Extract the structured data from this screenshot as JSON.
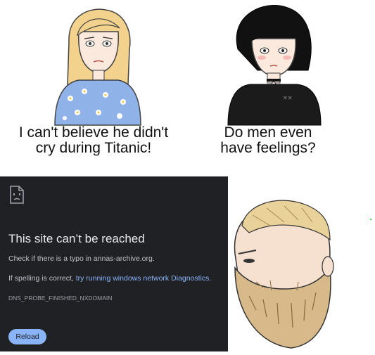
{
  "top_left": {
    "caption_line1": "I can't believe he didn't",
    "caption_line2": "cry during Titanic!"
  },
  "top_right": {
    "caption_line1": "Do men even",
    "caption_line2": "have feelings?"
  },
  "error_page": {
    "title": "This site can’t be reached",
    "check_text": "Check if there is a typo in annas-archive.org.",
    "spelling_prefix": "If spelling is correct, ",
    "diagnostics_link": "try running windows network Diagnostics.",
    "error_code": "DNS_PROBE_FINISHED_NXDOMAIN",
    "reload_label": "Reload"
  },
  "colors": {
    "dark_bg": "#202124",
    "link_blue": "#8ab4f8",
    "text_gray": "#bdc1c6",
    "title_white": "#e8eaed"
  },
  "icons": {
    "sad_page": "sad-page-icon"
  }
}
